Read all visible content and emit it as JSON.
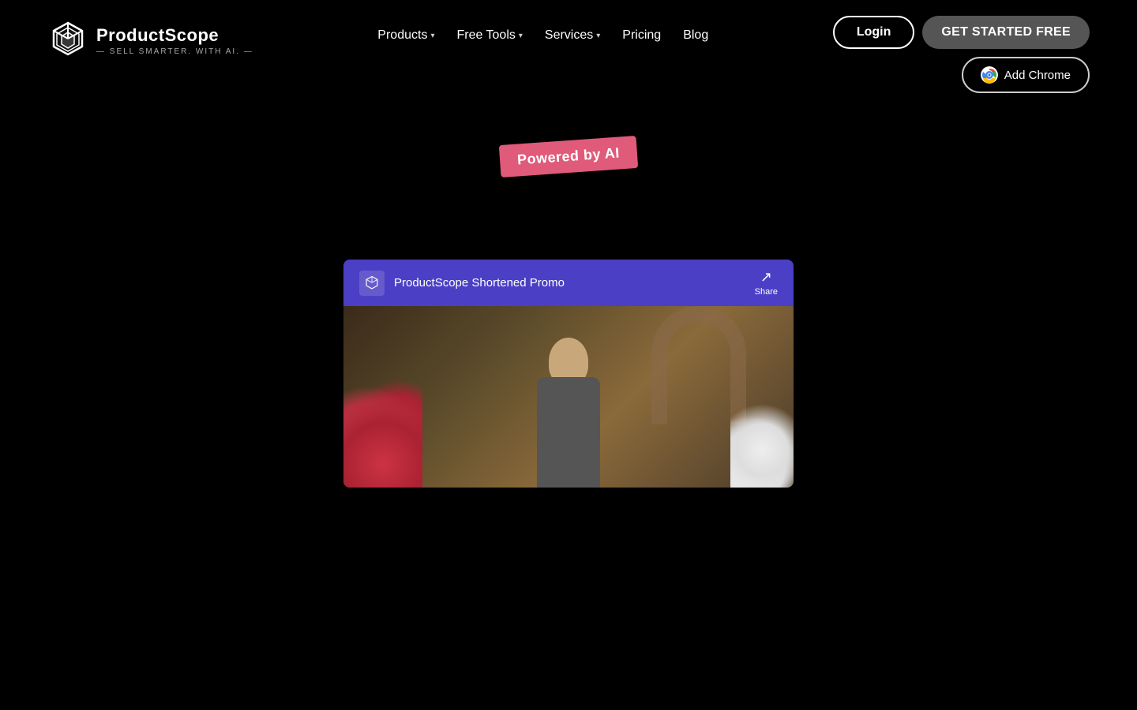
{
  "brand": {
    "name": "ProductScope",
    "tagline": "— SELL SMARTER. WITH AI. —"
  },
  "nav": {
    "items": [
      {
        "label": "Products",
        "hasDropdown": true
      },
      {
        "label": "Free Tools",
        "hasDropdown": true
      },
      {
        "label": "Services",
        "hasDropdown": true
      },
      {
        "label": "Pricing",
        "hasDropdown": false
      },
      {
        "label": "Blog",
        "hasDropdown": false
      }
    ],
    "loginLabel": "Login",
    "getStartedLabel": "GET STARTED FREE",
    "addChromeLabel": "Add Chrome"
  },
  "hero": {
    "poweredByLabel": "Powered by AI"
  },
  "video": {
    "channelName": "ProductScope Shortened Promo",
    "shareLabel": "Share"
  }
}
